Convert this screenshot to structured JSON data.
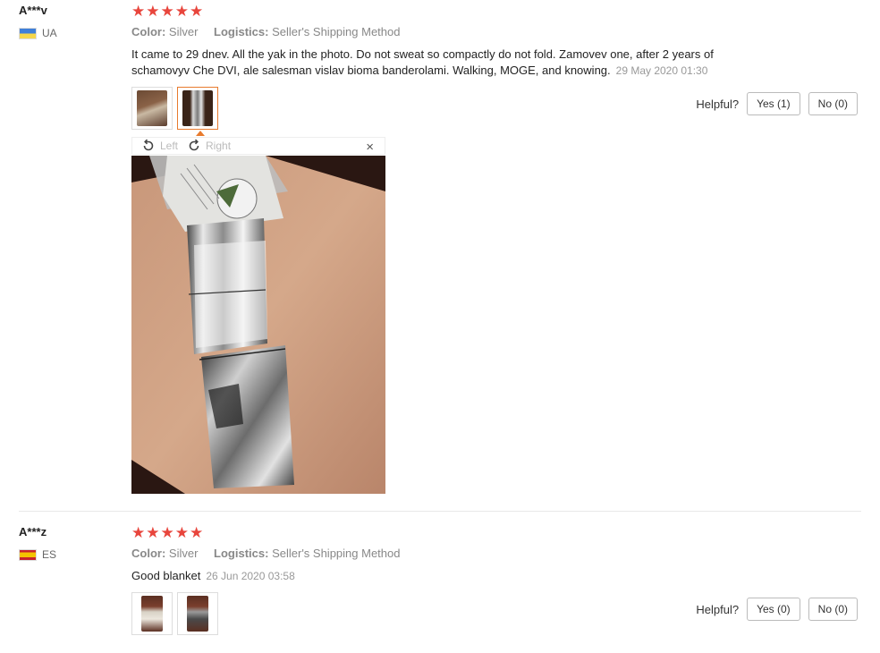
{
  "reviews": [
    {
      "user": "A***v",
      "country": "UA",
      "stars": 5,
      "color_label": "Color:",
      "color_value": "Silver",
      "logistics_label": "Logistics:",
      "logistics_value": "Seller's Shipping Method",
      "text": "It came to 29 dnev. All the yak in the photo. Do not sweat so compactly do not fold. Zamovev one, after 2 years of schamovyv Che DVI, ale salesman vislav bioma banderolami. Walking, MOGE, and knowing.",
      "date": "29 May 2020 01:30",
      "helpful_label": "Helpful?",
      "yes_label": "Yes (1)",
      "no_label": "No (0)"
    },
    {
      "user": "A***z",
      "country": "ES",
      "stars": 5,
      "color_label": "Color:",
      "color_value": "Silver",
      "logistics_label": "Logistics:",
      "logistics_value": "Seller's Shipping Method",
      "text": "Good blanket",
      "date": "26 Jun 2020 03:58",
      "helpful_label": "Helpful?",
      "yes_label": "Yes (0)",
      "no_label": "No (0)"
    }
  ],
  "viewer": {
    "rotate_left_label": "Left",
    "rotate_right_label": "Right",
    "close_glyph": "×",
    "icons": [
      "rotate-left-icon",
      "rotate-right-icon",
      "close-icon"
    ]
  },
  "colors": {
    "star": "#e8453c",
    "active_thumb": "#e87b2e"
  }
}
